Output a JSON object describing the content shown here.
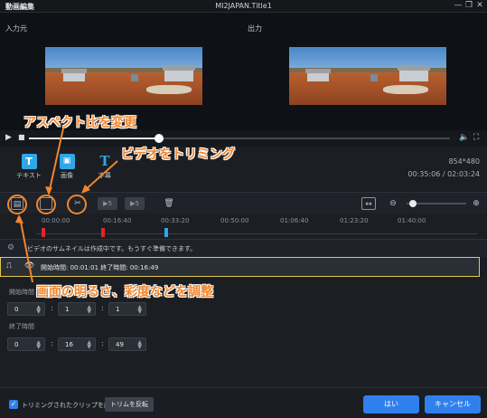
{
  "titlebar": {
    "app_title": "動画編集",
    "document": "MI2JAPAN.Title1",
    "minimize_glyph": "—",
    "restore_glyph": "❐",
    "close_glyph": "✕"
  },
  "preview": {
    "input_label": "入力元",
    "output_label": "出力"
  },
  "player": {
    "progress_fraction": 0.31
  },
  "tools": {
    "text_label": "テキスト",
    "image_label": "画像",
    "subtitle_label": "字幕",
    "resolution": "854*480",
    "timecode": "00:35:06 / 02:03:24"
  },
  "timeline_toolbar": {
    "skip_back_label": "▶5",
    "skip_fwd_label": "▶5",
    "zoom_fraction": 0.1
  },
  "ruler": {
    "ticks": [
      "00:00:00",
      "00:16:40",
      "00:33:20",
      "00:50:00",
      "01:06:40",
      "01:23:20",
      "01:40:00"
    ]
  },
  "notice": {
    "text": "ビデオのサムネイルは作成中です。もうすぐ準備できます。"
  },
  "clip": {
    "info": "開始時間: 00:01:01   終了時間: 00:16:49"
  },
  "time_panel": {
    "start_label": "開始時間",
    "end_label": "終了時間",
    "start_h": "0",
    "start_m": "1",
    "start_s": "1",
    "end_h": "0",
    "end_m": "16",
    "end_s": "49"
  },
  "footer": {
    "merge_label": "トリミングされたクリップを結合",
    "reverse_label": "トリムを反転",
    "ok_label": "はい",
    "cancel_label": "キャンセル"
  },
  "annotations": {
    "aspect": "アスペクト比を変更",
    "trim": "ビデオをトリミング",
    "brightness": "画面の明るさ、彩度などを調整"
  },
  "colors": {
    "accent": "#2f80ed",
    "callout": "#f0862c",
    "clip_border": "#e0c94e",
    "marker_red": "#e0262c",
    "marker_blue": "#2fa6e8"
  }
}
